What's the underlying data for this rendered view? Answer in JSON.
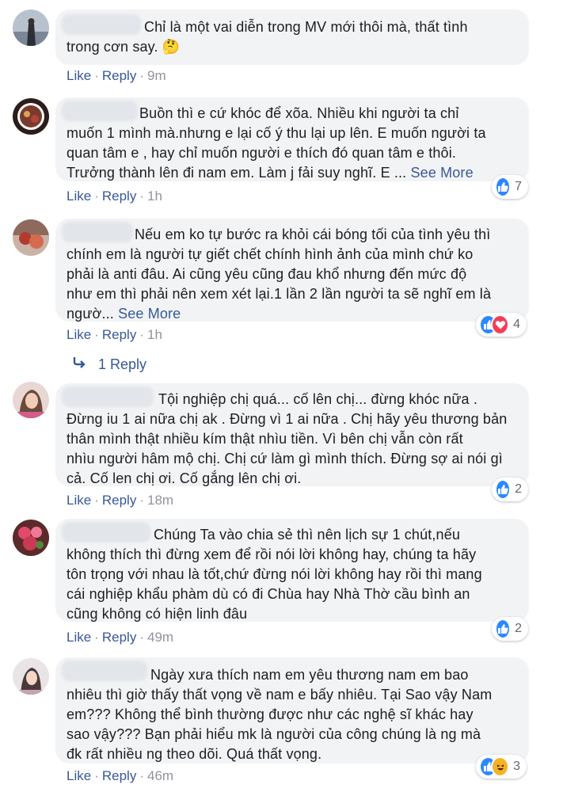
{
  "actions": {
    "like": "Like",
    "reply": "Reply",
    "see_more": "See More"
  },
  "comments": [
    {
      "text": "Chỉ là một vai diễn trong MV mới thôi mà, thất tình\ntrong cơn say. 🤔",
      "time": "9m"
    },
    {
      "text": "Buồn thì e cứ khóc để xõa. Nhiều khi người ta chỉ\nmuốn 1 mình mà.nhưng e lại cố ý thu lại up lên. E muốn người ta\nquan tâm e , hay chỉ muốn người e thích đó quan tâm e thôi.\nTrưởng thành lên đi nam em. Làm j fải suy nghĩ. E ...",
      "time": "1h",
      "reactions": {
        "icons": [
          "like"
        ],
        "count": "7"
      }
    },
    {
      "text": "Nếu em ko tự bước ra khỏi cái bóng tối của tình yêu thì\nchính em là người tự giết chết chính hình ảnh của mình chứ ko\nphải là anti đâu. Ai cũng yêu cũng đau khổ nhưng đến mức độ\nnhư em thì phải nên xem xét lại.1 lần 2 lần người ta sẽ nghĩ em là\nngườ...",
      "time": "1h",
      "reactions": {
        "icons": [
          "like",
          "love"
        ],
        "count": "4"
      }
    },
    {
      "text": "Tội nghiệp chị quá... cố lên chị... đừng khóc nữa .\nĐừng iu 1 ai nữa chị ak . Đừng vì 1 ai nữa . Chị hãy yêu thương bản\nthân mình thật nhiều kím thật nhìu tiền. Vì bên chị vẫn còn rất\nnhìu người hâm mộ chị. Chị cứ làm gì mình thích. Đừng sợ ai nói gì\ncả. Cố len chị ơi. Cố gắng lên chị ơi.",
      "time": "18m",
      "reactions": {
        "icons": [
          "like"
        ],
        "count": "2"
      }
    },
    {
      "text": "Chúng Ta vào chia sẻ thì nên lịch sự 1 chút,nếu\nkhông thích thì đừng xem để rồi nói lời không hay, chúng ta hãy\ntôn trọng với nhau là tốt,chứ đừng nói lời không hay rồi thì mang\ncái nghiệp khẩu phàm dù có đi Chùa hay Nhà Thờ cầu bình an\ncũng không có hiện linh đâu",
      "time": "49m",
      "reactions": {
        "icons": [
          "like"
        ],
        "count": "2"
      }
    },
    {
      "text": "Ngày xưa thích nam em yêu thương nam em bao\nnhiêu thì giờ thấy thất vọng về nam e bấy nhiêu. Tại Sao vậy Nam\nem??? Không thể bình thường được như các nghệ sĩ khác hay\nsao vậy??? Bạn phải hiểu mk là người của công chúng là ng mà\nđk rất nhiều ng theo dõi. Quá thất vọng.",
      "time": "46m",
      "reactions": {
        "icons": [
          "like",
          "haha"
        ],
        "count": "3"
      }
    }
  ],
  "reply_thread": {
    "label": "1 Reply"
  },
  "colors": {
    "link": "#385898",
    "bubble": "#f2f3f5",
    "like": "#2d88ff",
    "love": "#f33e58",
    "haha": "#f7b125"
  }
}
